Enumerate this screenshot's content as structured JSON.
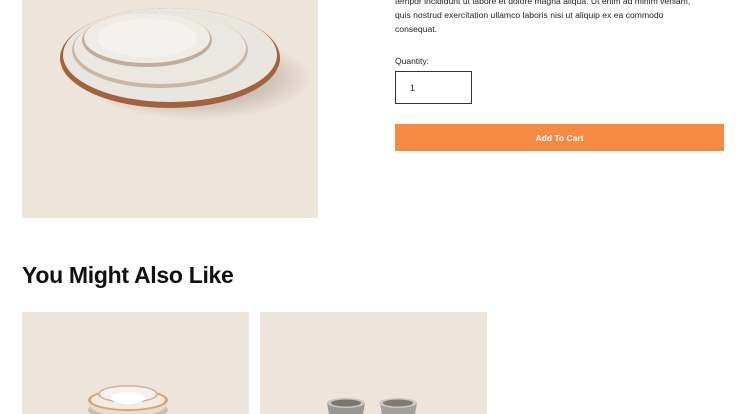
{
  "product": {
    "image_icon": "plates-stack-image",
    "description": "tempor incididunt ut labore et dolore magna aliqua. Ut enim ad minim veniam,\nquis nostrud exercitation ullamco laboris nisi ut aliquip ex ea commodo\nconsequat.",
    "quantity_label": "Quantity:",
    "quantity_value": "1",
    "add_to_cart_label": "Add To Cart"
  },
  "related": {
    "title": "You Might Also Like",
    "items": [
      {
        "image_icon": "nested-bowls-image"
      },
      {
        "image_icon": "ceramic-cups-image"
      }
    ]
  },
  "colors": {
    "accent": "#f58a43",
    "image_bg": "#ede4da"
  }
}
